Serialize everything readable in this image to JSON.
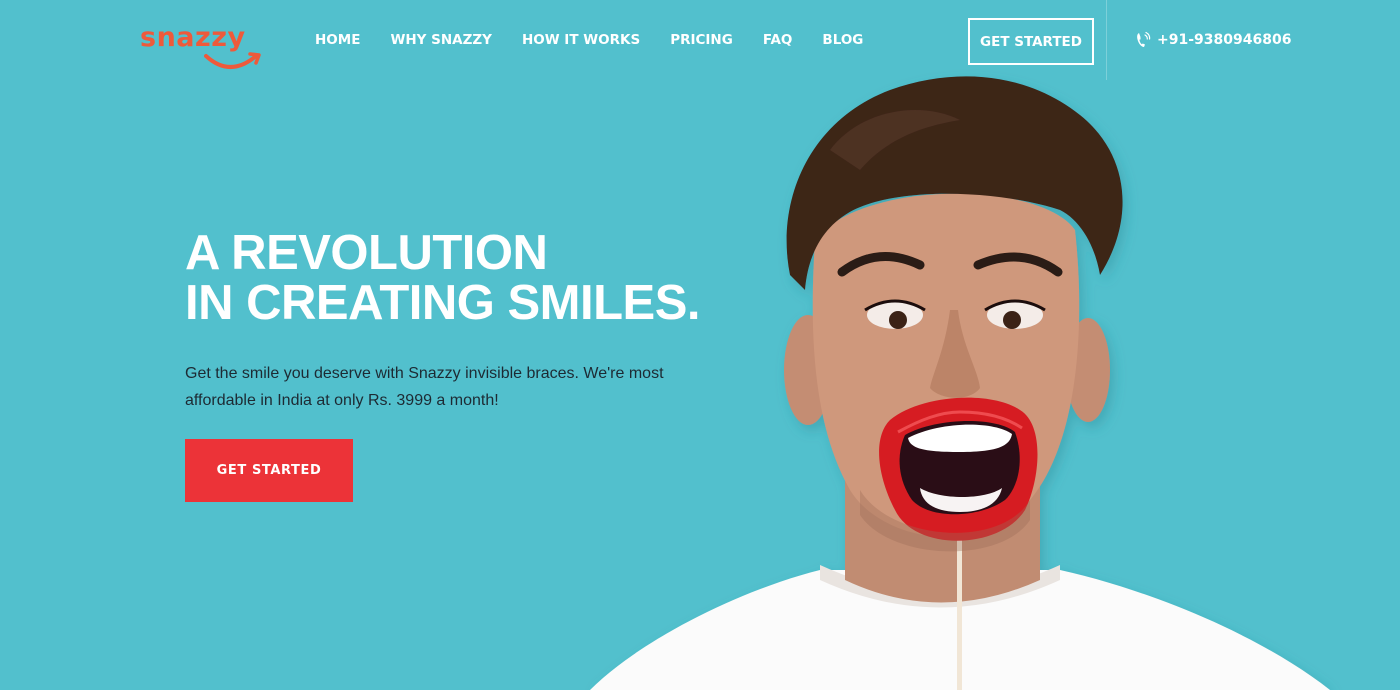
{
  "brand": {
    "logo_text": "snazzy",
    "accent_color": "#ee5a3b"
  },
  "nav": {
    "items": [
      {
        "label": "HOME"
      },
      {
        "label": "WHY SNAZZY"
      },
      {
        "label": "HOW IT WORKS"
      },
      {
        "label": "PRICING"
      },
      {
        "label": "FAQ"
      },
      {
        "label": "BLOG"
      }
    ]
  },
  "header": {
    "cta_label": "GET STARTED",
    "phone_icon": "phone-icon",
    "phone_number": "+91-9380946806"
  },
  "hero": {
    "title_line1": "A REVOLUTION",
    "title_line2": "IN CREATING SMILES.",
    "subtitle": "Get the smile you deserve with Snazzy invisible braces. We're most affordable in India at only Rs. 3999 a month!",
    "cta_label": "GET STARTED",
    "cta_color": "#ec3338",
    "background_color": "#52c0cd"
  }
}
